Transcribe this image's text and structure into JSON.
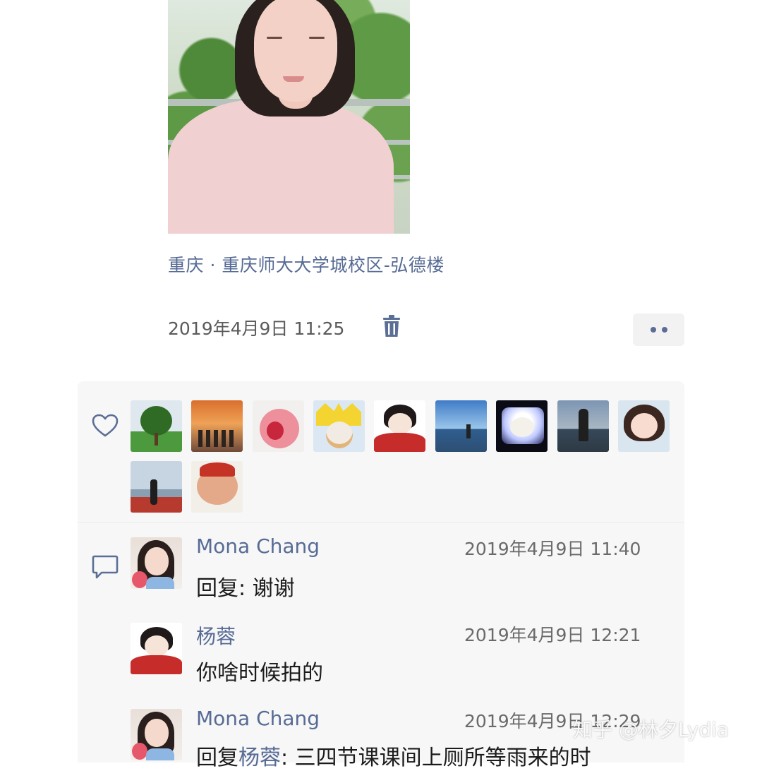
{
  "post": {
    "location": "重庆 · 重庆师大大学城校区-弘德楼",
    "time": "2019年4月9日 11:25"
  },
  "icons": {
    "delete": "trash-icon",
    "more": "more-dots-icon",
    "like": "heart-icon",
    "comment": "comment-bubble-icon"
  },
  "likes": {
    "avatars": [
      "tree",
      "sunset-group",
      "pink-dinosaur",
      "dog-with-hat",
      "cartoon-girl-red",
      "person-by-sea",
      "white-dog-night",
      "man-by-lake",
      "cartoon-girl",
      "girl-at-harbor",
      "cartoon-pig"
    ]
  },
  "comments": [
    {
      "name": "Mona Chang",
      "time": "2019年4月9日 11:40",
      "prefix": "回复: ",
      "mention": "",
      "text": "谢谢",
      "avatar": "mona-avatar"
    },
    {
      "name": "杨蓉",
      "time": "2019年4月9日 12:21",
      "prefix": "",
      "mention": "",
      "text": "你啥时候拍的",
      "avatar": "cartoon-girl-red"
    },
    {
      "name": "Mona Chang",
      "time": "2019年4月9日 12:29",
      "prefix": "回复",
      "mention": "杨蓉",
      "text": ": 三四节课课间上厕所等雨来的时",
      "avatar": "mona-avatar"
    }
  ],
  "watermark": "知乎 @林夕Lydia",
  "colors": {
    "link": "#576b95",
    "panel_bg": "#f7f7f7"
  }
}
